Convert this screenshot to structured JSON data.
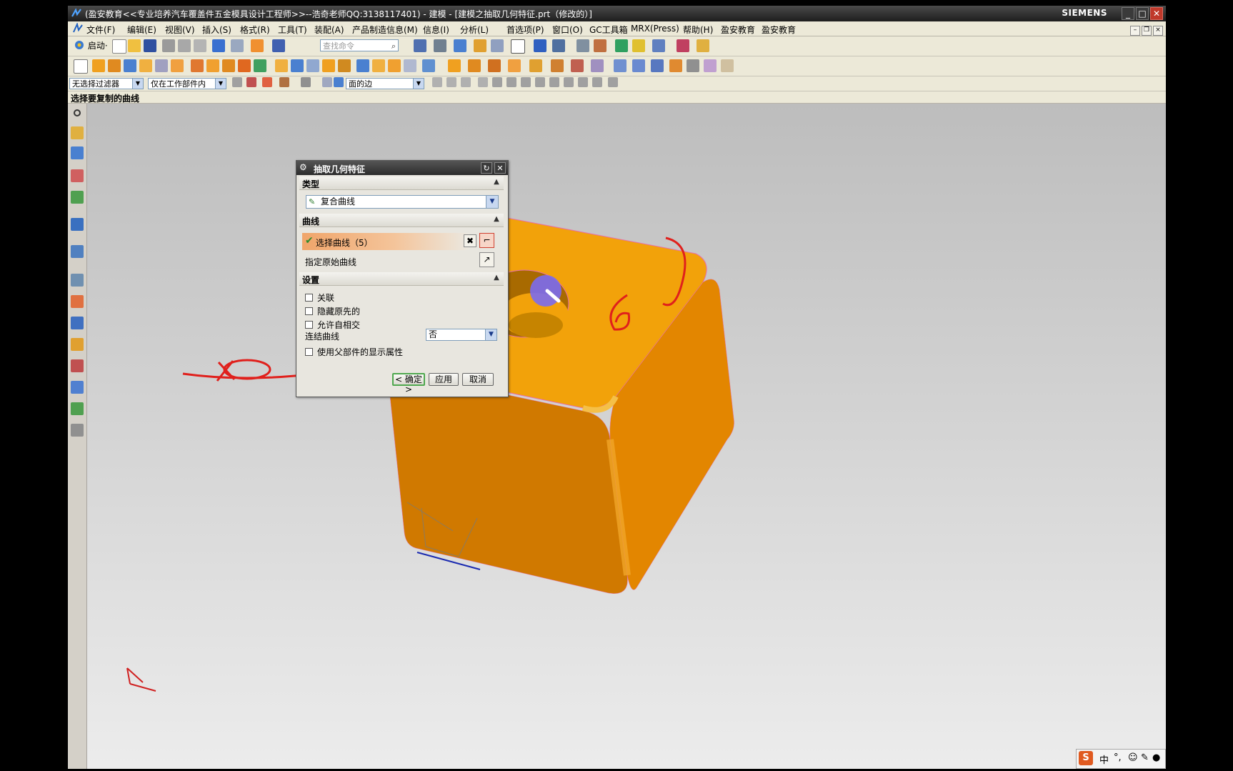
{
  "window": {
    "title": "(盈安教育<<专业培养汽车覆盖件五金模具设计工程师>>--浩奇老师QQ:3138117401) - 建模 - [建模之抽取几何特征.prt（修改的）]",
    "brand": "SIEMENS",
    "minimize": "_",
    "maximize": "□",
    "close": "✕"
  },
  "menubar": {
    "items": [
      "文件(F)",
      "编辑(E)",
      "视图(V)",
      "插入(S)",
      "格式(R)",
      "工具(T)",
      "装配(A)",
      "产品制造信息(M)",
      "信息(I)",
      "分析(L)",
      "首选项(P)",
      "窗口(O)",
      "GC工具箱",
      "MRX(Press)",
      "帮助(H)",
      "盈安教育",
      "盈安教育"
    ]
  },
  "toolbar": {
    "start_label": "启动·",
    "search_placeholder": "查找命令"
  },
  "selection_bar": {
    "filter": "无选择过滤器",
    "scope": "仅在工作部件内",
    "rule": "面的边"
  },
  "cue_line": "选择要复制的曲线",
  "dialog": {
    "title": "抽取几何特征",
    "sections": {
      "type": "类型",
      "curve": "曲线",
      "settings": "设置"
    },
    "type_value": "复合曲线",
    "select_curve": "选择曲线（5）",
    "specify_original": "指定原始曲线",
    "associative": "关联",
    "hide_original": "隐藏原先的",
    "allow_self_intersect": "允许自相交",
    "join_curves_label": "连结曲线",
    "join_curves_value": "否",
    "use_parent_display": "使用父部件的显示属性",
    "ok": "< 确定 >",
    "apply": "应用",
    "cancel": "取消"
  },
  "ime": {
    "lang": "中",
    "punct": "°,",
    "emoji": "☺"
  },
  "colors": {
    "part_face": "#f2a20a",
    "part_side": "#e07f00",
    "hole": "#c68400",
    "selection": "#7b6cf0",
    "annotation": "#e0201c"
  }
}
